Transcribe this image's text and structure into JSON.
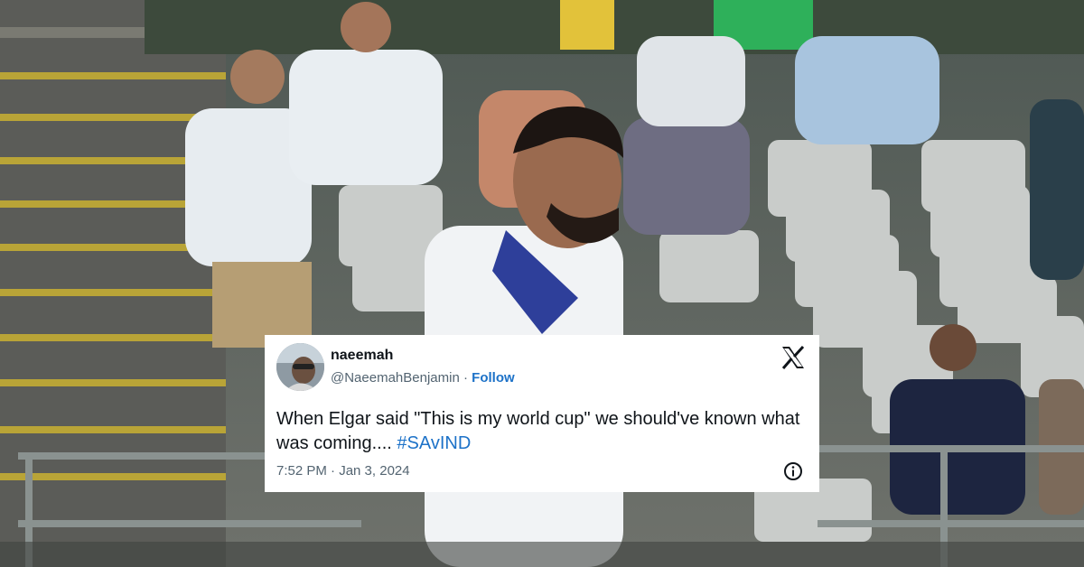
{
  "tweet": {
    "display_name": "naeemah",
    "handle": "@NaeemahBenjamin",
    "separator": "·",
    "follow_label": "Follow",
    "text_main": "When Elgar said \"This is my world cup\" we should've known what was coming.... ",
    "hashtag": "#SAvIND",
    "timestamp": "7:52 PM · Jan 3, 2024"
  },
  "icons": {
    "platform_logo": "x-logo-icon",
    "info": "info-icon",
    "avatar": "avatar"
  },
  "colors": {
    "link": "#1d72c8",
    "text": "#0f1419",
    "secondary": "#536471",
    "card_bg": "#ffffff"
  }
}
